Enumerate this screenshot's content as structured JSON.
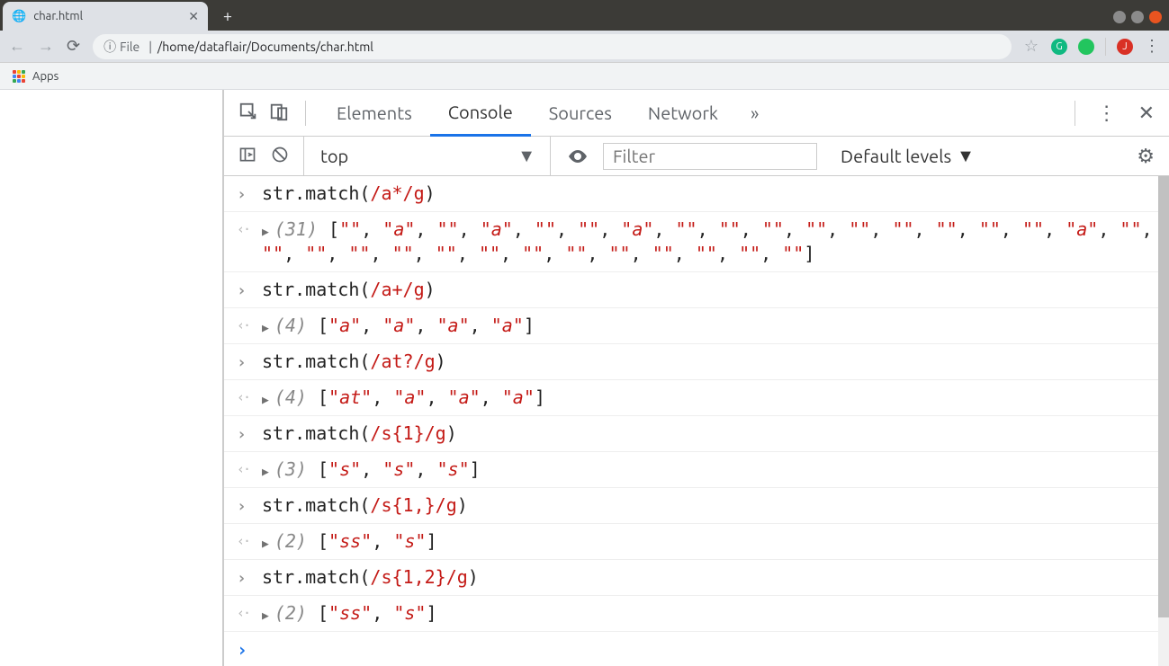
{
  "browser": {
    "tab_title": "char.html",
    "url_scheme_label": "File",
    "url_path": "/home/dataflair/Documents/char.html",
    "apps_label": "Apps",
    "info_icon_char": "ⓘ"
  },
  "devtools": {
    "tabs": [
      "Elements",
      "Console",
      "Sources",
      "Network"
    ],
    "active_tab": "Console",
    "more_glyph": "»"
  },
  "console_toolbar": {
    "context": "top",
    "filter_placeholder": "Filter",
    "levels_label": "Default levels",
    "caret": "▼"
  },
  "entries": [
    {
      "input_prefix": "str.match(",
      "input_regex": "/a*/g",
      "input_suffix": ")",
      "count": 31,
      "result": [
        "",
        "a",
        "",
        "a",
        "",
        "",
        "a",
        "",
        "",
        "",
        "",
        "",
        "",
        "",
        "",
        "",
        "a",
        "",
        "",
        "",
        "",
        "",
        "",
        "",
        "",
        "",
        "",
        "",
        "",
        "",
        ""
      ]
    },
    {
      "input_prefix": "str.match(",
      "input_regex": "/a+/g",
      "input_suffix": ")",
      "count": 4,
      "result": [
        "a",
        "a",
        "a",
        "a"
      ]
    },
    {
      "input_prefix": "str.match(",
      "input_regex": "/at?/g",
      "input_suffix": ")",
      "count": 4,
      "result": [
        "at",
        "a",
        "a",
        "a"
      ]
    },
    {
      "input_prefix": "str.match(",
      "input_regex": "/s{1}/g",
      "input_suffix": ")",
      "count": 3,
      "result": [
        "s",
        "s",
        "s"
      ]
    },
    {
      "input_prefix": "str.match(",
      "input_regex": "/s{1,}/g",
      "input_suffix": ")",
      "count": 2,
      "result": [
        "ss",
        "s"
      ]
    },
    {
      "input_prefix": "str.match(",
      "input_regex": "/s{1,2}/g",
      "input_suffix": ")",
      "count": 2,
      "result": [
        "ss",
        "s"
      ]
    }
  ]
}
